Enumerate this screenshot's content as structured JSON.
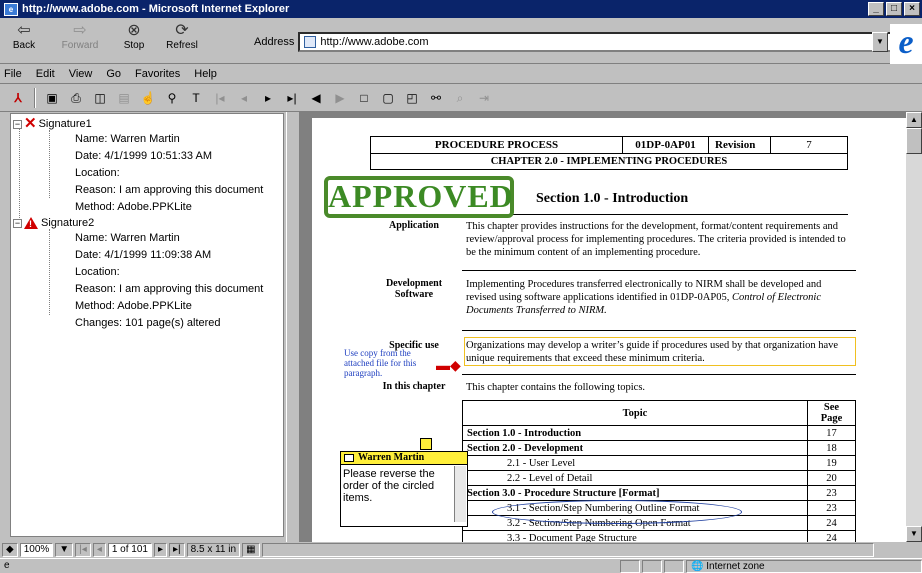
{
  "window": {
    "title": "http://www.adobe.com - Microsoft Internet Explorer",
    "controls": [
      "_",
      "□",
      "×"
    ]
  },
  "toolbar": {
    "buttons": [
      {
        "label": "Back",
        "icon": "back-arrow-icon",
        "glyph": "⇦",
        "enabled": true
      },
      {
        "label": "Forward",
        "icon": "forward-arrow-icon",
        "glyph": "⇨",
        "enabled": false
      },
      {
        "label": "Stop",
        "icon": "stop-icon",
        "glyph": "⊗",
        "enabled": true
      },
      {
        "label": "Refresl",
        "icon": "refresh-icon",
        "glyph": "⟳",
        "enabled": true
      }
    ],
    "address_label": "Address",
    "address_value": "http://www.adobe.com"
  },
  "menu": [
    "File",
    "Edit",
    "View",
    "Go",
    "Favorites",
    "Help"
  ],
  "acrobat_toolbar": [
    "acrobat-logo-icon",
    "save-icon",
    "print-icon",
    "show-pane-icon",
    "thumbnails-icon",
    "hand-tool-icon",
    "zoom-tool-icon",
    "text-select-icon",
    "first-page-icon",
    "previous-page-icon",
    "next-page-icon",
    "last-page-icon",
    "go-back-icon",
    "go-forward-icon",
    "actual-size-icon",
    "fit-page-icon",
    "fit-width-icon",
    "find-icon",
    "web-search-icon",
    "web-link-icon"
  ],
  "signatures": [
    {
      "name": "Signature1",
      "status": "invalid",
      "details": [
        "Name: Warren Martin",
        "Date: 4/1/1999 10:51:33 AM",
        "Location:",
        "Reason: I am approving this document",
        "Method: Adobe.PPKLite"
      ]
    },
    {
      "name": "Signature2",
      "status": "warning",
      "details": [
        "Name: Warren Martin",
        "Date: 4/1/1999 11:09:38 AM",
        "Location:",
        "Reason: I am approving this document",
        "Method: Adobe.PPKLite",
        "Changes: 101 page(s) altered"
      ]
    }
  ],
  "document": {
    "header": {
      "process": "PROCEDURE PROCESS",
      "code": "01DP-0AP01",
      "revision_label": "Revision",
      "revision": "7",
      "chapter": "CHAPTER 2.0 - IMPLEMENTING PROCEDURES",
      "section": "Section 1.0 - Introduction"
    },
    "stamp": "APPROVED",
    "application": {
      "label": "Application",
      "text": "This chapter provides instructions for the development, format/content requirements and review/approval process for implementing procedures. The criteria provided is intended to be the minimum content of an implementing procedure."
    },
    "dev_software": {
      "label1": "Development",
      "label2": "Software",
      "text1": "Implementing Procedures transferred electronically to NIRM shall be developed and",
      "text2": "revised using software applications identified in 01DP-0AP05,",
      "text2_italic": "Control of Electronic",
      "text3_italic": "Documents Transferred to NIRM."
    },
    "specific_use": {
      "label": "Specific use",
      "text": "Organizations may develop a writer’s guide if procedures used by that organization have unique requirements that exceed these minimum criteria.",
      "annotation": "Use copy from the attached file for this paragraph."
    },
    "in_chapter": {
      "label": "In this chapter",
      "text": "This chapter contains the following topics."
    },
    "topics_header": {
      "topic": "Topic",
      "page": "See Page"
    },
    "topics": [
      {
        "topic": "Section 1.0 - Introduction",
        "page": "17",
        "bold": true
      },
      {
        "topic": "Section 2.0 - Development",
        "page": "18",
        "bold": true
      },
      {
        "topic": "2.1 - User Level",
        "page": "19",
        "bold": false
      },
      {
        "topic": "2.2 - Level of Detail",
        "page": "20",
        "bold": false
      },
      {
        "topic": "Section 3.0 - Procedure Structure [Format]",
        "page": "23",
        "bold": true
      },
      {
        "topic": "3.1 - Section/Step Numbering Outline Format",
        "page": "23",
        "bold": false
      },
      {
        "topic": "3.2 - Section/Step Numbering Open Format",
        "page": "24",
        "bold": false
      },
      {
        "topic": "3.3 - Document Page Structure",
        "page": "24",
        "bold": false
      }
    ],
    "note": {
      "author": "Warren Martin",
      "text": "Please reverse the order of the circled items."
    }
  },
  "status": {
    "zoom": "100%",
    "page": "1 of 101",
    "page_size": "8.5 x 11 in",
    "zone": "Internet zone"
  }
}
